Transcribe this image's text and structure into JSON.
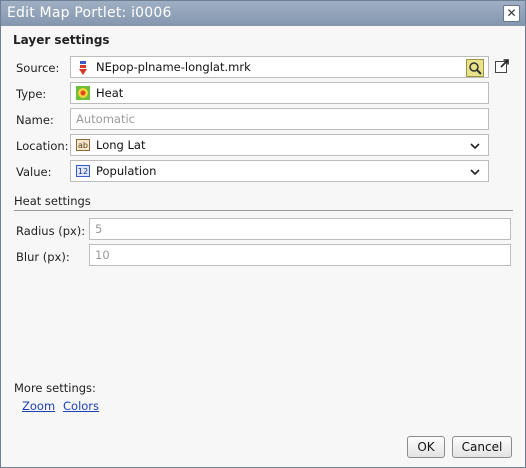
{
  "window": {
    "title": "Edit Map Portlet: i0006"
  },
  "layer": {
    "section_title": "Layer settings",
    "source_label": "Source:",
    "source_value": "NEpop-plname-longlat.mrk",
    "type_label": "Type:",
    "type_value": "Heat",
    "name_label": "Name:",
    "name_placeholder": "Automatic",
    "location_label": "Location:",
    "location_value": "Long Lat",
    "value_label": "Value:",
    "value_value": "Population",
    "value_icon_text": "12",
    "location_icon_text": "ab"
  },
  "heat": {
    "section_title": "Heat settings",
    "radius_label": "Radius (px):",
    "radius_value": "5",
    "blur_label": "Blur (px):",
    "blur_value": "10"
  },
  "more": {
    "label": "More settings:",
    "links": [
      "Zoom",
      "Colors"
    ]
  },
  "buttons": {
    "ok": "OK",
    "cancel": "Cancel"
  },
  "colors": {
    "titlebar": "#8c9db3",
    "link": "#1a3fb5"
  }
}
